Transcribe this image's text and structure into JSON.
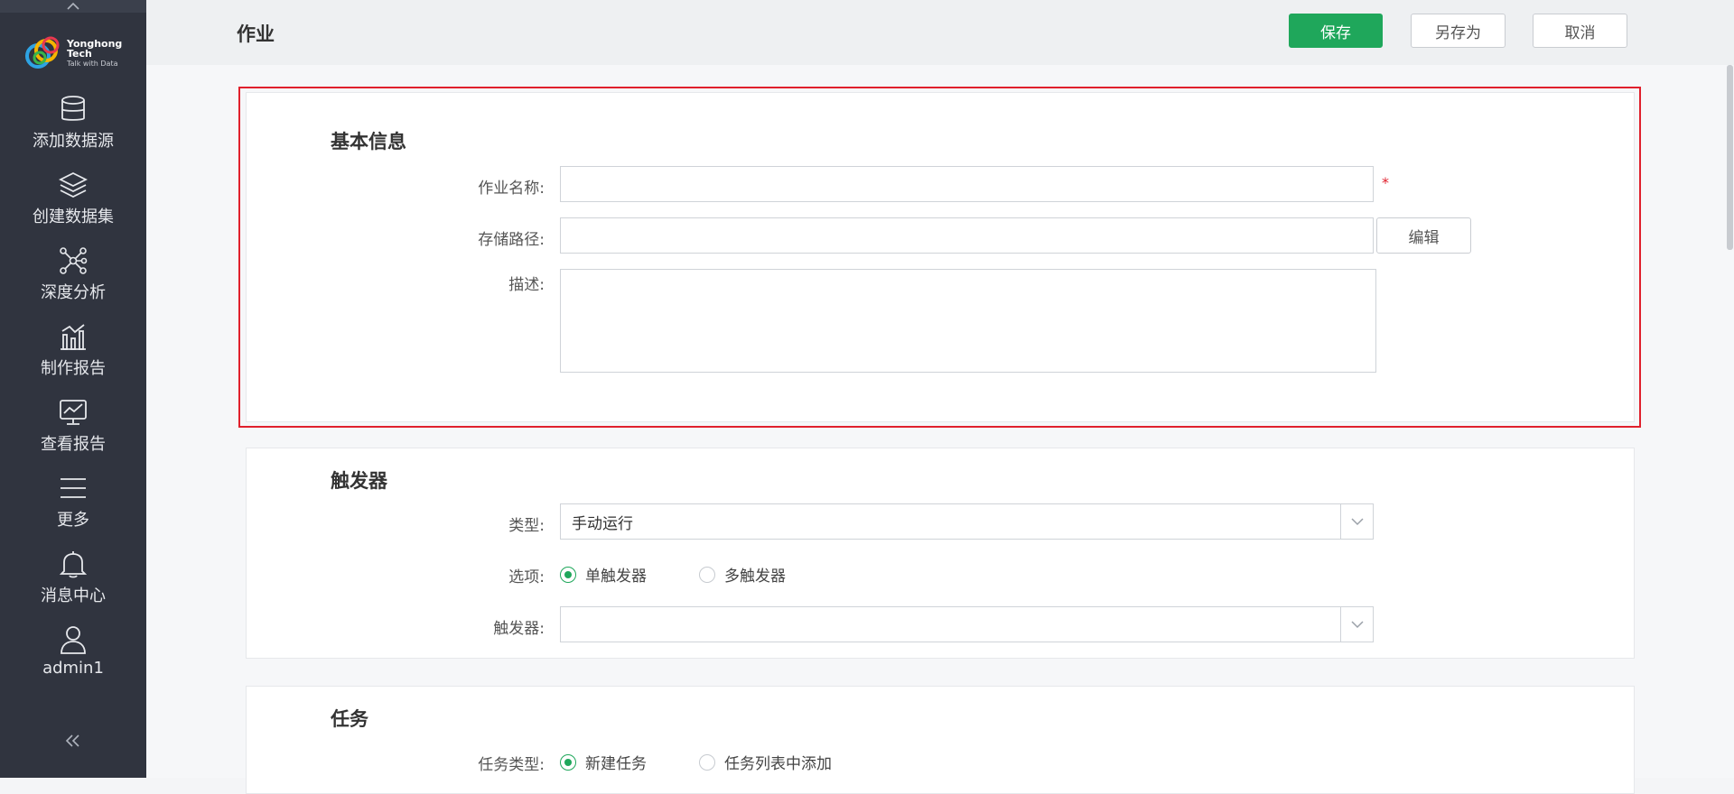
{
  "sidebar": {
    "logo": {
      "brand": "Yonghong Tech",
      "slogan": "Talk with Data"
    },
    "items": [
      {
        "label": "添加数据源",
        "icon": "database-icon"
      },
      {
        "label": "创建数据集",
        "icon": "layers-icon"
      },
      {
        "label": "深度分析",
        "icon": "network-icon"
      },
      {
        "label": "制作报告",
        "icon": "bar-chart-icon"
      },
      {
        "label": "查看报告",
        "icon": "monitor-chart-icon"
      },
      {
        "label": "更多",
        "icon": "menu-icon"
      },
      {
        "label": "消息中心",
        "icon": "bell-icon"
      },
      {
        "label": "admin1",
        "icon": "user-icon"
      }
    ]
  },
  "header": {
    "title": "作业",
    "save_label": "保存",
    "save_as_label": "另存为",
    "cancel_label": "取消"
  },
  "basic_info": {
    "title": "基本信息",
    "job_name_label": "作业名称:",
    "job_name_value": "",
    "required_mark": "*",
    "storage_path_label": "存储路径:",
    "storage_path_value": "",
    "edit_label": "编辑",
    "description_label": "描述:",
    "description_value": ""
  },
  "trigger": {
    "title": "触发器",
    "type_label": "类型:",
    "type_value": "手动运行",
    "option_label": "选项:",
    "options": [
      {
        "label": "单触发器",
        "selected": true
      },
      {
        "label": "多触发器",
        "selected": false
      }
    ],
    "trigger_label": "触发器:",
    "trigger_value": ""
  },
  "task": {
    "title": "任务",
    "task_type_label": "任务类型:",
    "options": [
      {
        "label": "新建任务",
        "selected": true
      },
      {
        "label": "任务列表中添加",
        "selected": false
      }
    ]
  },
  "colors": {
    "accent": "#1fa75b",
    "highlight": "#e0202c",
    "sidebar": "#30343f"
  }
}
